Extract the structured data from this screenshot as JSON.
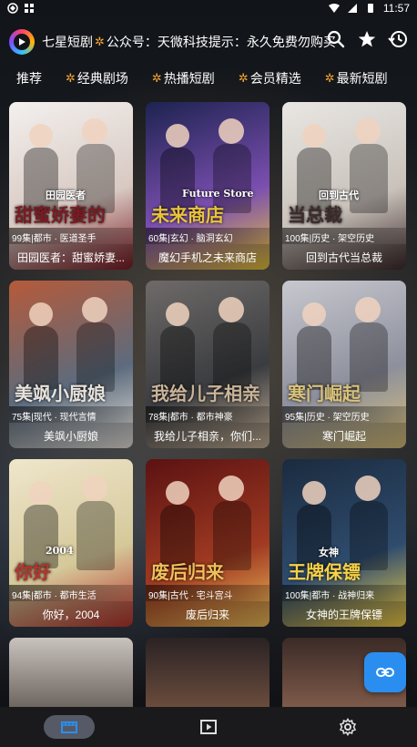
{
  "status_bar": {
    "time": "11:57"
  },
  "header": {
    "app_name": "七星短剧",
    "notice": "公众号：天微科技提示：永久免费勿购买",
    "icons": [
      "search-icon",
      "star-icon",
      "history-icon"
    ]
  },
  "tabs": [
    {
      "label": "推荐",
      "gear": false
    },
    {
      "label": "经典剧场",
      "gear": true
    },
    {
      "label": "热播短剧",
      "gear": true
    },
    {
      "label": "会员精选",
      "gear": true
    },
    {
      "label": "最新短剧",
      "gear": true
    }
  ],
  "cards": [
    {
      "tag": "99集|都市 · 医道圣手",
      "title": "田园医者：甜蜜娇妻...",
      "poster_text": "甜蜜娇妻的",
      "poster_sub": "田园医者",
      "colors": [
        "#f3f0ee",
        "#d8c9c2",
        "#7a1a22"
      ]
    },
    {
      "tag": "60集|玄幻 · 脑洞玄幻",
      "title": "魔幻手机之未来商店",
      "poster_text": "未来商店",
      "poster_sub": "Future Store",
      "colors": [
        "#1d2350",
        "#7b4fb0",
        "#e8c43a"
      ]
    },
    {
      "tag": "100集|历史 · 架空历史",
      "title": "回到古代当总裁",
      "poster_text": "当总裁",
      "poster_sub": "回到古代",
      "colors": [
        "#e9e7e3",
        "#c9c2bb",
        "#3d2b2a"
      ]
    },
    {
      "tag": "75集|现代 · 现代言情",
      "title": "美飒小厨娘",
      "poster_text": "美飒小厨娘",
      "poster_sub": "",
      "colors": [
        "#b65a3a",
        "#5c6b7d",
        "#e8e4de"
      ]
    },
    {
      "tag": "78集|都市 · 都市神豪",
      "title": "我给儿子相亲，你们...",
      "poster_text": "我给儿子相亲",
      "poster_sub": "",
      "colors": [
        "#6e6a68",
        "#3a3c40",
        "#c9b49a"
      ]
    },
    {
      "tag": "95集|历史 · 架空历史",
      "title": "寒门崛起",
      "poster_text": "寒门崛起",
      "poster_sub": "",
      "colors": [
        "#c7c8cf",
        "#8d8f9c",
        "#d9c27a"
      ]
    },
    {
      "tag": "94集|都市 · 都市生活",
      "title": "你好，2004",
      "poster_text": "你好",
      "poster_sub": "2004",
      "colors": [
        "#efe6cc",
        "#d5c99a",
        "#b7332c"
      ]
    },
    {
      "tag": "90集|古代 · 宅斗宫斗",
      "title": "废后归来",
      "poster_text": "废后归来",
      "poster_sub": "",
      "colors": [
        "#5b1212",
        "#a03a22",
        "#f0c05a"
      ]
    },
    {
      "tag": "100集|都市 · 战神归来",
      "title": "女神的王牌保镖",
      "poster_text": "王牌保镖",
      "poster_sub": "女神",
      "colors": [
        "#1b2b3f",
        "#2f4c6e",
        "#f7d248"
      ]
    }
  ],
  "partial_cards": [
    {
      "colors": [
        "#c9c3bd",
        "#6e6660"
      ]
    },
    {
      "colors": [
        "#2a2224",
        "#6a4c3c"
      ]
    },
    {
      "colors": [
        "#3b2a26",
        "#7d5a4a"
      ]
    }
  ],
  "fab": {
    "icon": "link-icon"
  },
  "bottom_nav": [
    {
      "icon": "film-icon",
      "active": true
    },
    {
      "icon": "play-icon",
      "active": false
    },
    {
      "icon": "settings-icon",
      "active": false
    }
  ]
}
